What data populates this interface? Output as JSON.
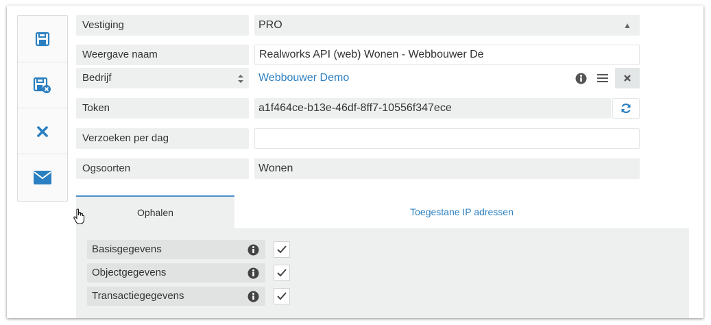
{
  "toolbar": {
    "items": [
      {
        "icon": "save-icon"
      },
      {
        "icon": "save-close-icon"
      },
      {
        "icon": "close-icon"
      },
      {
        "icon": "mail-icon"
      }
    ]
  },
  "form": {
    "vestiging": {
      "label": "Vestiging",
      "value": "PRO"
    },
    "weergave_naam": {
      "label": "Weergave naam",
      "value": "Realworks API (web) Wonen - Webbouwer De"
    },
    "bedrijf": {
      "label": "Bedrijf",
      "value": "Webbouwer Demo"
    },
    "token": {
      "label": "Token",
      "value": "a1f464ce-b13e-46df-8ff7-10556f347ece"
    },
    "verzoeken": {
      "label": "Verzoeken per dag",
      "value": ""
    },
    "ogsoorten": {
      "label": "Ogsoorten",
      "value": "Wonen"
    }
  },
  "tabs": [
    {
      "label": "Ophalen",
      "active": true
    },
    {
      "label": "Toegestane IP adressen",
      "active": false
    }
  ],
  "checks": [
    {
      "label": "Basisgegevens",
      "checked": true
    },
    {
      "label": "Objectgegevens",
      "checked": true
    },
    {
      "label": "Transactiegegevens",
      "checked": true
    }
  ],
  "colors": {
    "accent": "#2a7fc1",
    "panel": "#eef0f0"
  }
}
